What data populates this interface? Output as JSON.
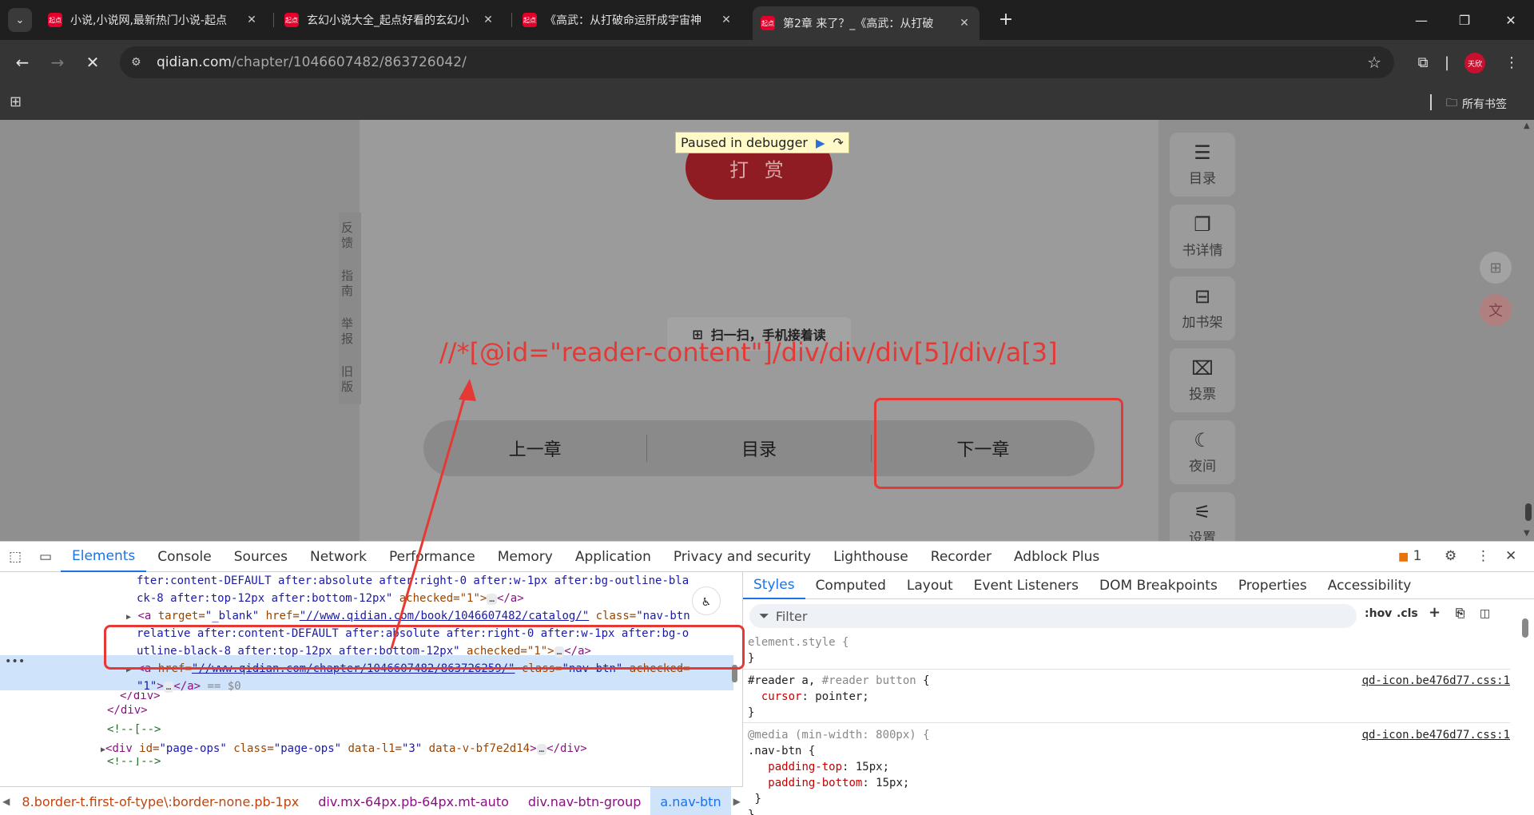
{
  "browser": {
    "tabs": [
      {
        "favicon": "起点",
        "title": "小说,小说网,最新热门小说-起点"
      },
      {
        "favicon": "起点",
        "title": "玄幻小说大全_起点好看的玄幻小"
      },
      {
        "favicon": "起点",
        "title": "《高武：从打破命运肝成宇宙神"
      },
      {
        "favicon": "起点",
        "title": "第2章 来了？_《高武：从打破"
      }
    ],
    "url_host": "qidian.com",
    "url_path": "/chapter/1046607482/863726042/",
    "profile_label": "天欣",
    "bookmarks_folder": "所有书签"
  },
  "page": {
    "debugger_label": "Paused in debugger",
    "reward_label": "打 赏",
    "left_tabs": [
      "反馈",
      "指南",
      "举报",
      "旧版"
    ],
    "qr_hint": "扫一扫，手机接着读",
    "xpath_annotation": "//*[@id=\"reader-content\"]/div/div/div[5]/div/a[3]",
    "chapter_nav": {
      "prev": "上一章",
      "toc": "目录",
      "next": "下一章"
    },
    "rail": [
      {
        "icon": "list-icon",
        "glyph": "☰",
        "label": "目录"
      },
      {
        "icon": "book-icon",
        "glyph": "📖",
        "label": "书详情"
      },
      {
        "icon": "bookshelf-add-icon",
        "glyph": "⊞",
        "label": "加书架"
      },
      {
        "icon": "vote-icon",
        "glyph": "⌧",
        "label": "投票"
      },
      {
        "icon": "moon-icon",
        "glyph": "☾",
        "label": "夜间"
      },
      {
        "icon": "settings-sliders-icon",
        "glyph": "⚟",
        "label": "设置"
      }
    ]
  },
  "devtools": {
    "tabs": [
      "Elements",
      "Console",
      "Sources",
      "Network",
      "Performance",
      "Memory",
      "Application",
      "Privacy and security",
      "Lighthouse",
      "Recorder",
      "Adblock Plus"
    ],
    "active_tab": "Elements",
    "issues_count": "1",
    "dom": {
      "line1": "fter:content-DEFAULT after:absolute after:right-0 after:w-1px after:bg-outline-bla",
      "line2a": "ck-8 after:top-12px after:bottom-12px\"",
      "line2b": " achecked=\"1\">",
      "line3_tag": "<a",
      "line3_attr1": " target=",
      "line3_val1": "\"_blank\"",
      "line3_attr2": " href=",
      "line3_val2": "\"//www.qidian.com/book/1046607482/catalog/\"",
      "line3_attr3": " class=",
      "line3_val3": "\"nav-btn",
      "line4": "relative after:content-DEFAULT after:absolute after:right-0 after:w-1px after:bg-o",
      "line5a": "utline-black-8 after:top-12px after:bottom-12px\"",
      "line5b": " achecked=\"1\">",
      "sel_tag": "<a",
      "sel_attr1": " href=",
      "sel_val1": "\"//www.qidian.com/chapter/1046607482/863726259/\"",
      "sel_attr2": " class=",
      "sel_val2": "\"nav-btn\"",
      "sel_attr3": " achecked=",
      "sel_val3": "\"1\"",
      "sel_suffix": "</a>",
      "sel_eq": " == $0",
      "close_a": "</a>",
      "close_div": "</div>",
      "close_div2": "</div>",
      "comment1": "<!--[-->",
      "div_tag": "<div",
      "div_attr1": " id=",
      "div_val1": "\"page-ops\"",
      "div_attr2": " class=",
      "div_val2": "\"page-ops\"",
      "div_attr3": " data-l1=",
      "div_val3": "\"3\"",
      "div_attr4": " data-v-bf7e2d14",
      "div_close": "</div>",
      "comment2": "<!--]-->"
    },
    "breadcrumbs": [
      "8.border-t.first-of-type\\:border-none.pb-1px",
      "div.mx-64px.pb-64px.mt-auto",
      "div.nav-btn-group",
      "a.nav-btn"
    ],
    "styles_tabs": [
      "Styles",
      "Computed",
      "Layout",
      "Event Listeners",
      "DOM Breakpoints",
      "Properties",
      "Accessibility"
    ],
    "filter_placeholder": "Filter",
    "filter_hov": ":hov",
    "filter_cls": ".cls",
    "rules": {
      "element_style": "element.style {",
      "close": "}",
      "r1_sel_a": "#reader a",
      "r1_sel_comma": ", ",
      "r1_sel_b": "#reader button",
      "r1_open": " {",
      "r1_prop": "cursor",
      "r1_val": ": pointer;",
      "r1_source": "qd-icon.be476d77.css:1",
      "r2_media": "@media (min-width: 800px) {",
      "r2_sel": ".nav-btn {",
      "r2_prop1": "padding-top",
      "r2_val1": ": 15px;",
      "r2_prop2": "padding-bottom",
      "r2_val2": ": 15px;",
      "r2_source": "qd-icon.be476d77.css:1"
    }
  },
  "colors": {
    "annotation_red": "#e53935",
    "accent_blue": "#1a73e8",
    "qidian_red": "#e4002b"
  }
}
